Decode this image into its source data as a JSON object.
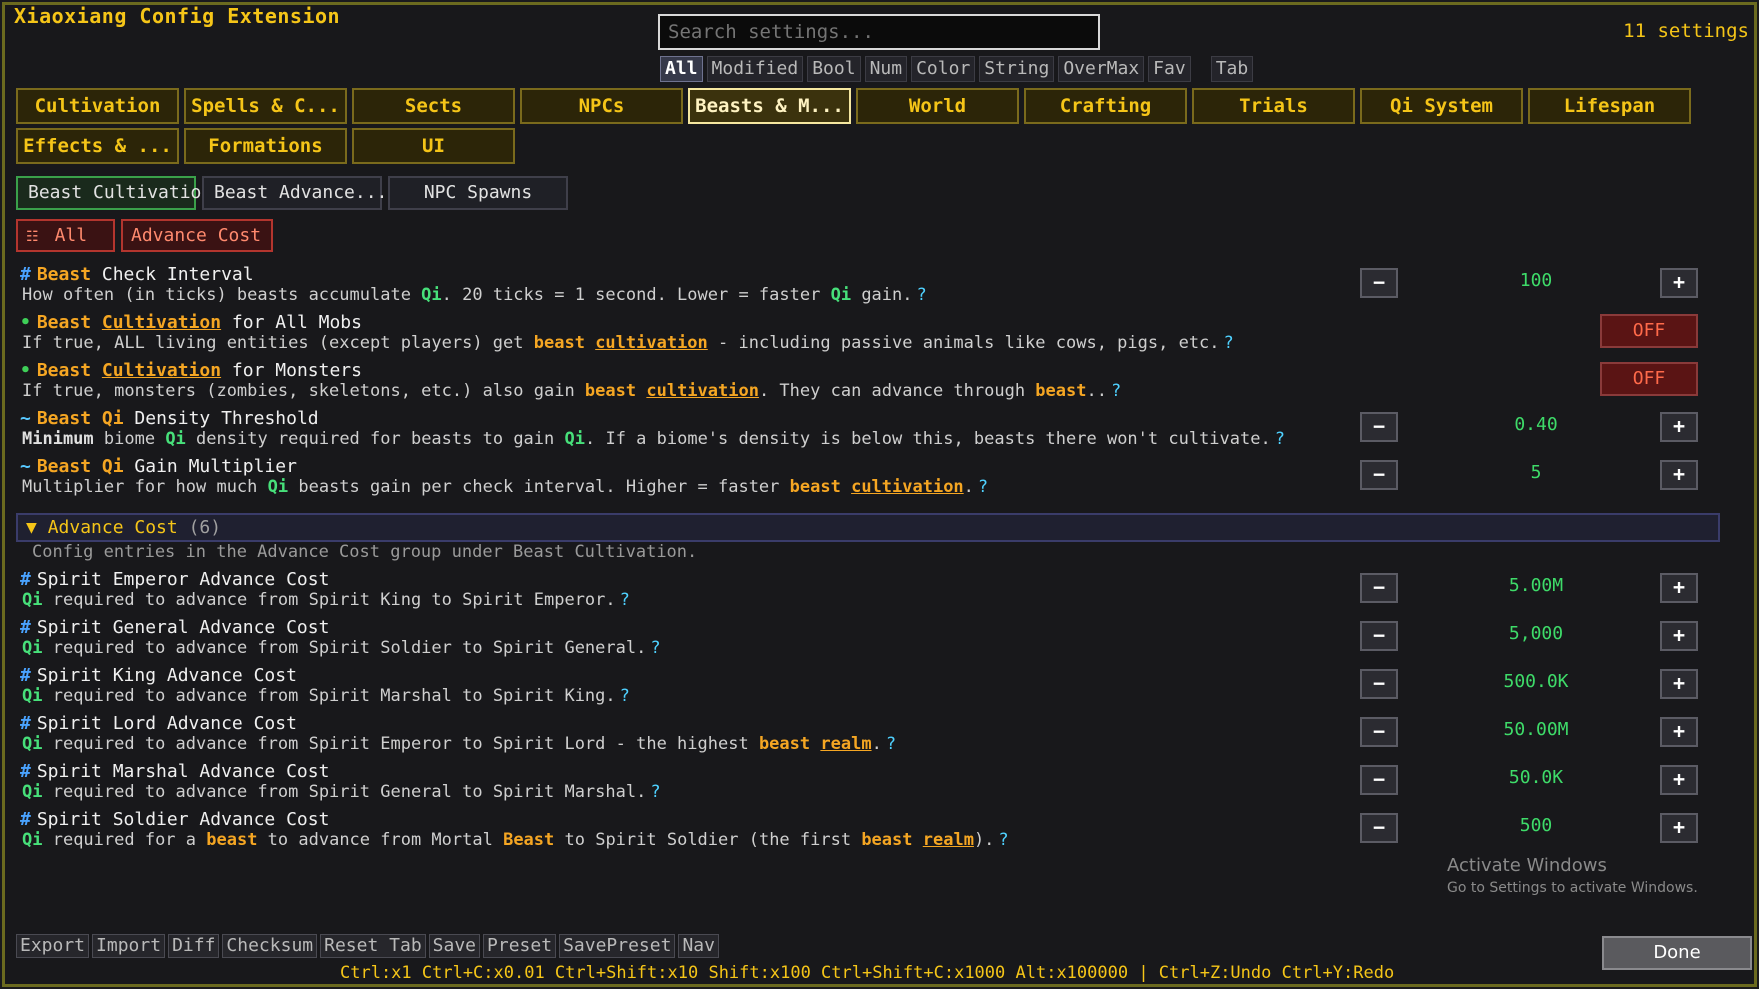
{
  "window": {
    "title": "Xiaoxiang Config Extension",
    "settings_count": "11 settings"
  },
  "search": {
    "placeholder": "Search settings..."
  },
  "filters": [
    {
      "label": "All",
      "active": true
    },
    {
      "label": "Modified"
    },
    {
      "label": "Bool"
    },
    {
      "label": "Num"
    },
    {
      "label": "Color"
    },
    {
      "label": "String"
    },
    {
      "label": "OverMax"
    },
    {
      "label": "Fav"
    },
    {
      "label": "Tab"
    }
  ],
  "categories": [
    "Cultivation",
    "Spells & C...",
    "Sects",
    "NPCs",
    "Beasts & M...",
    "World",
    "Crafting",
    "Trials",
    "Qi System",
    "Lifespan",
    "Effects & ...",
    "Formations",
    "UI"
  ],
  "active_category": "Beasts & M...",
  "subtabs": [
    "Beast Cultivatio",
    "Beast Advance...",
    "NPC Spawns"
  ],
  "groups": {
    "all": "All",
    "advance_cost": "Advance Cost"
  },
  "entries": {
    "check_interval": {
      "label_kw": "Beast",
      "label_rest": " Check Interval",
      "desc_a": "How often (in ticks) beasts accumulate ",
      "desc_qi1": "Qi",
      "desc_b": ". 20 ticks = 1 second. Lower = faster ",
      "desc_qi2": "Qi",
      "desc_c": " gain.",
      "value": "100"
    },
    "all_mobs": {
      "label_kw": "Beast",
      "label_kwu": "Cultivation",
      "label_rest": " for All Mobs",
      "desc_a": "If true, ALL living entities (except players) get ",
      "desc_kw": "beast",
      "desc_kwu": "cultivation",
      "desc_b": " - including passive animals like cows, pigs, etc.",
      "value": "OFF"
    },
    "monsters": {
      "label_kw": "Beast",
      "label_kwu": "Cultivation",
      "label_rest": " for Monsters",
      "desc_a": "If true, monsters (zombies, skeletons, etc.) also gain ",
      "desc_kw": "beast",
      "desc_kwu": "cultivation",
      "desc_b": ". They can advance through ",
      "desc_kw2": "beast",
      "desc_c": "..",
      "value": "OFF"
    },
    "density": {
      "label_kw": "Beast",
      "label_qi": "Qi",
      "label_rest": " Density Threshold",
      "desc_bold": "Minimum",
      "desc_a": " biome ",
      "desc_qi1": "Qi",
      "desc_b": " density required for beasts to gain ",
      "desc_qi2": "Qi",
      "desc_c": ". If a biome's density is below this, beasts there won't cultivate.",
      "value": "0.40"
    },
    "gain_mult": {
      "label_kw": "Beast",
      "label_qi": "Qi",
      "label_rest": " Gain Multiplier",
      "desc_a": "Multiplier for how much ",
      "desc_qi1": "Qi",
      "desc_b": " beasts gain per check interval. Higher = faster ",
      "desc_kw": "beast",
      "desc_kwu": "cultivation",
      "desc_c": ".",
      "value": "5"
    }
  },
  "section": {
    "title": "Advance Cost",
    "count": "(6)",
    "description": "Config entries in the Advance Cost group under Beast Cultivation."
  },
  "advance": [
    {
      "label": "Spirit Emperor Advance Cost",
      "desc": " required to advance from Spirit King to Spirit Emperor.",
      "value": "5.00M"
    },
    {
      "label": "Spirit General Advance Cost",
      "desc": " required to advance from Spirit Soldier to Spirit General.",
      "value": "5,000"
    },
    {
      "label": "Spirit King Advance Cost",
      "desc": " required to advance from Spirit Marshal to Spirit King.",
      "value": "500.0K"
    },
    {
      "label": "Spirit Lord Advance Cost",
      "desc": " required to advance from Spirit Emperor to Spirit Lord - the highest ",
      "desc_kw": "beast",
      "desc_kwu": "realm",
      "desc_end": ".",
      "value": "50.00M"
    },
    {
      "label": "Spirit Marshal Advance Cost",
      "desc": " required to advance from Spirit General to Spirit Marshal.",
      "value": "50.0K"
    },
    {
      "label": "Spirit Soldier Advance Cost",
      "desc": " required for a ",
      "desc_kw": "beast",
      "desc_mid": " to advance from Mortal ",
      "desc_kw2": "Beast",
      "desc_mid2": " to Spirit Soldier (the first ",
      "desc_kw3": "beast",
      "desc_kwu": "realm",
      "desc_end": ").",
      "value": "500"
    }
  ],
  "common": {
    "qi": "Qi",
    "help": "?",
    "minus": "−",
    "plus": "+",
    "expand": "▼"
  },
  "watermark": {
    "line1": "Activate Windows",
    "line2": "Go to Settings to activate Windows."
  },
  "bottom_buttons": [
    "Export",
    "Import",
    "Diff",
    "Checksum",
    "Reset Tab",
    "Save",
    "Preset",
    "SavePreset",
    "Nav"
  ],
  "done": "Done",
  "shortcuts": "Ctrl:x1  Ctrl+C:x0.01  Ctrl+Shift:x10  Shift:x100  Ctrl+Shift+C:x1000  Alt:x100000  |  Ctrl+Z:Undo  Ctrl+Y:Redo",
  "colors": {
    "accent": "#f5c518",
    "value": "#3edb69",
    "keyword": "#f5a623",
    "off": "#5a1414"
  }
}
